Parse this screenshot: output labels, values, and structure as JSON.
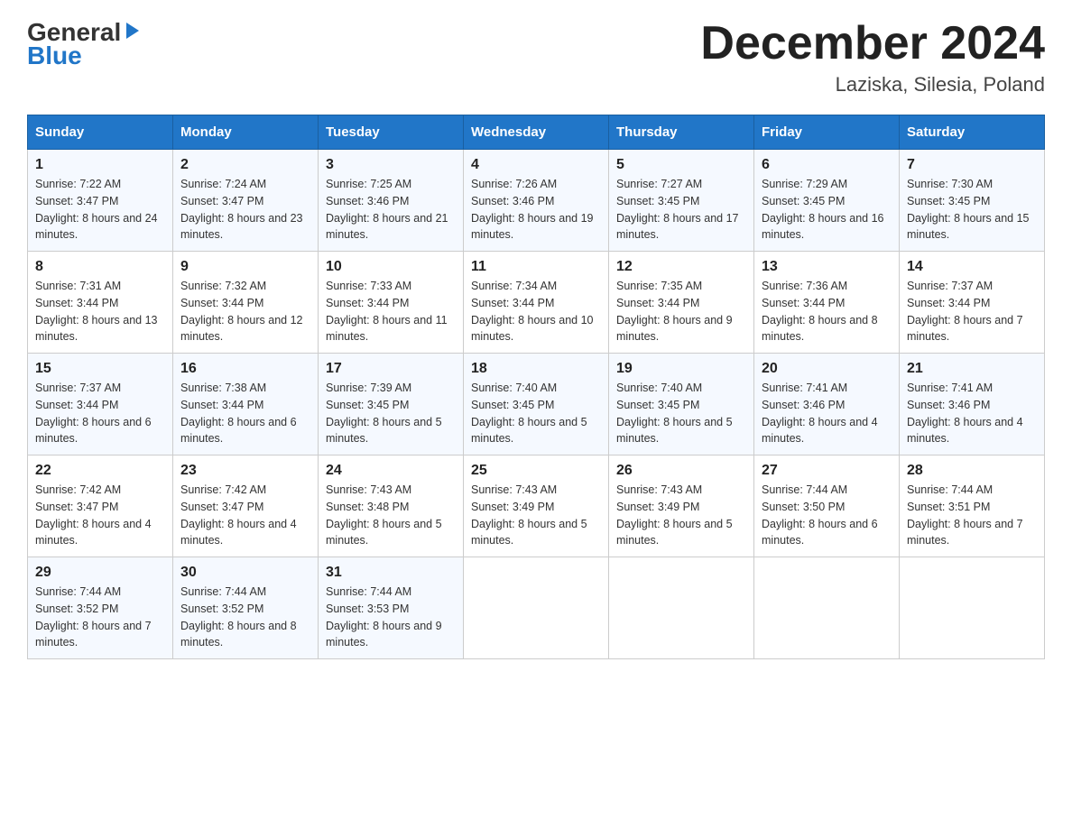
{
  "header": {
    "title": "December 2024",
    "subtitle": "Laziska, Silesia, Poland",
    "logo_general": "General",
    "logo_blue": "Blue"
  },
  "columns": [
    "Sunday",
    "Monday",
    "Tuesday",
    "Wednesday",
    "Thursday",
    "Friday",
    "Saturday"
  ],
  "weeks": [
    [
      {
        "day": "1",
        "sunrise": "7:22 AM",
        "sunset": "3:47 PM",
        "daylight": "8 hours and 24 minutes."
      },
      {
        "day": "2",
        "sunrise": "7:24 AM",
        "sunset": "3:47 PM",
        "daylight": "8 hours and 23 minutes."
      },
      {
        "day": "3",
        "sunrise": "7:25 AM",
        "sunset": "3:46 PM",
        "daylight": "8 hours and 21 minutes."
      },
      {
        "day": "4",
        "sunrise": "7:26 AM",
        "sunset": "3:46 PM",
        "daylight": "8 hours and 19 minutes."
      },
      {
        "day": "5",
        "sunrise": "7:27 AM",
        "sunset": "3:45 PM",
        "daylight": "8 hours and 17 minutes."
      },
      {
        "day": "6",
        "sunrise": "7:29 AM",
        "sunset": "3:45 PM",
        "daylight": "8 hours and 16 minutes."
      },
      {
        "day": "7",
        "sunrise": "7:30 AM",
        "sunset": "3:45 PM",
        "daylight": "8 hours and 15 minutes."
      }
    ],
    [
      {
        "day": "8",
        "sunrise": "7:31 AM",
        "sunset": "3:44 PM",
        "daylight": "8 hours and 13 minutes."
      },
      {
        "day": "9",
        "sunrise": "7:32 AM",
        "sunset": "3:44 PM",
        "daylight": "8 hours and 12 minutes."
      },
      {
        "day": "10",
        "sunrise": "7:33 AM",
        "sunset": "3:44 PM",
        "daylight": "8 hours and 11 minutes."
      },
      {
        "day": "11",
        "sunrise": "7:34 AM",
        "sunset": "3:44 PM",
        "daylight": "8 hours and 10 minutes."
      },
      {
        "day": "12",
        "sunrise": "7:35 AM",
        "sunset": "3:44 PM",
        "daylight": "8 hours and 9 minutes."
      },
      {
        "day": "13",
        "sunrise": "7:36 AM",
        "sunset": "3:44 PM",
        "daylight": "8 hours and 8 minutes."
      },
      {
        "day": "14",
        "sunrise": "7:37 AM",
        "sunset": "3:44 PM",
        "daylight": "8 hours and 7 minutes."
      }
    ],
    [
      {
        "day": "15",
        "sunrise": "7:37 AM",
        "sunset": "3:44 PM",
        "daylight": "8 hours and 6 minutes."
      },
      {
        "day": "16",
        "sunrise": "7:38 AM",
        "sunset": "3:44 PM",
        "daylight": "8 hours and 6 minutes."
      },
      {
        "day": "17",
        "sunrise": "7:39 AM",
        "sunset": "3:45 PM",
        "daylight": "8 hours and 5 minutes."
      },
      {
        "day": "18",
        "sunrise": "7:40 AM",
        "sunset": "3:45 PM",
        "daylight": "8 hours and 5 minutes."
      },
      {
        "day": "19",
        "sunrise": "7:40 AM",
        "sunset": "3:45 PM",
        "daylight": "8 hours and 5 minutes."
      },
      {
        "day": "20",
        "sunrise": "7:41 AM",
        "sunset": "3:46 PM",
        "daylight": "8 hours and 4 minutes."
      },
      {
        "day": "21",
        "sunrise": "7:41 AM",
        "sunset": "3:46 PM",
        "daylight": "8 hours and 4 minutes."
      }
    ],
    [
      {
        "day": "22",
        "sunrise": "7:42 AM",
        "sunset": "3:47 PM",
        "daylight": "8 hours and 4 minutes."
      },
      {
        "day": "23",
        "sunrise": "7:42 AM",
        "sunset": "3:47 PM",
        "daylight": "8 hours and 4 minutes."
      },
      {
        "day": "24",
        "sunrise": "7:43 AM",
        "sunset": "3:48 PM",
        "daylight": "8 hours and 5 minutes."
      },
      {
        "day": "25",
        "sunrise": "7:43 AM",
        "sunset": "3:49 PM",
        "daylight": "8 hours and 5 minutes."
      },
      {
        "day": "26",
        "sunrise": "7:43 AM",
        "sunset": "3:49 PM",
        "daylight": "8 hours and 5 minutes."
      },
      {
        "day": "27",
        "sunrise": "7:44 AM",
        "sunset": "3:50 PM",
        "daylight": "8 hours and 6 minutes."
      },
      {
        "day": "28",
        "sunrise": "7:44 AM",
        "sunset": "3:51 PM",
        "daylight": "8 hours and 7 minutes."
      }
    ],
    [
      {
        "day": "29",
        "sunrise": "7:44 AM",
        "sunset": "3:52 PM",
        "daylight": "8 hours and 7 minutes."
      },
      {
        "day": "30",
        "sunrise": "7:44 AM",
        "sunset": "3:52 PM",
        "daylight": "8 hours and 8 minutes."
      },
      {
        "day": "31",
        "sunrise": "7:44 AM",
        "sunset": "3:53 PM",
        "daylight": "8 hours and 9 minutes."
      },
      null,
      null,
      null,
      null
    ]
  ],
  "labels": {
    "sunrise": "Sunrise:",
    "sunset": "Sunset:",
    "daylight": "Daylight:"
  }
}
